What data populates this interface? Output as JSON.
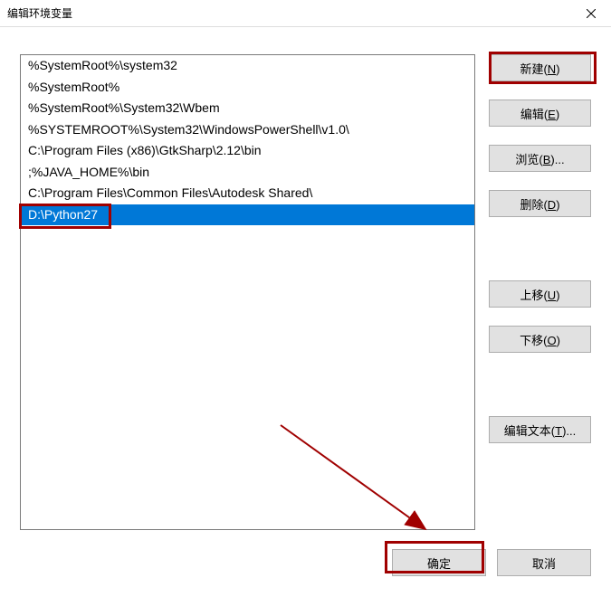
{
  "window": {
    "title": "编辑环境变量"
  },
  "list": {
    "items": [
      "%SystemRoot%\\system32",
      "%SystemRoot%",
      "%SystemRoot%\\System32\\Wbem",
      "%SYSTEMROOT%\\System32\\WindowsPowerShell\\v1.0\\",
      "C:\\Program Files (x86)\\GtkSharp\\2.12\\bin",
      ";%JAVA_HOME%\\bin",
      "C:\\Program Files\\Common Files\\Autodesk Shared\\",
      "D:\\Python27"
    ],
    "selected_index": 7
  },
  "buttons": {
    "new": "新建(N)",
    "edit": "编辑(E)",
    "browse": "浏览(B)...",
    "delete": "删除(D)",
    "moveup": "上移(U)",
    "movedown": "下移(O)",
    "edittext": "编辑文本(T)...",
    "ok": "确定",
    "cancel": "取消"
  }
}
